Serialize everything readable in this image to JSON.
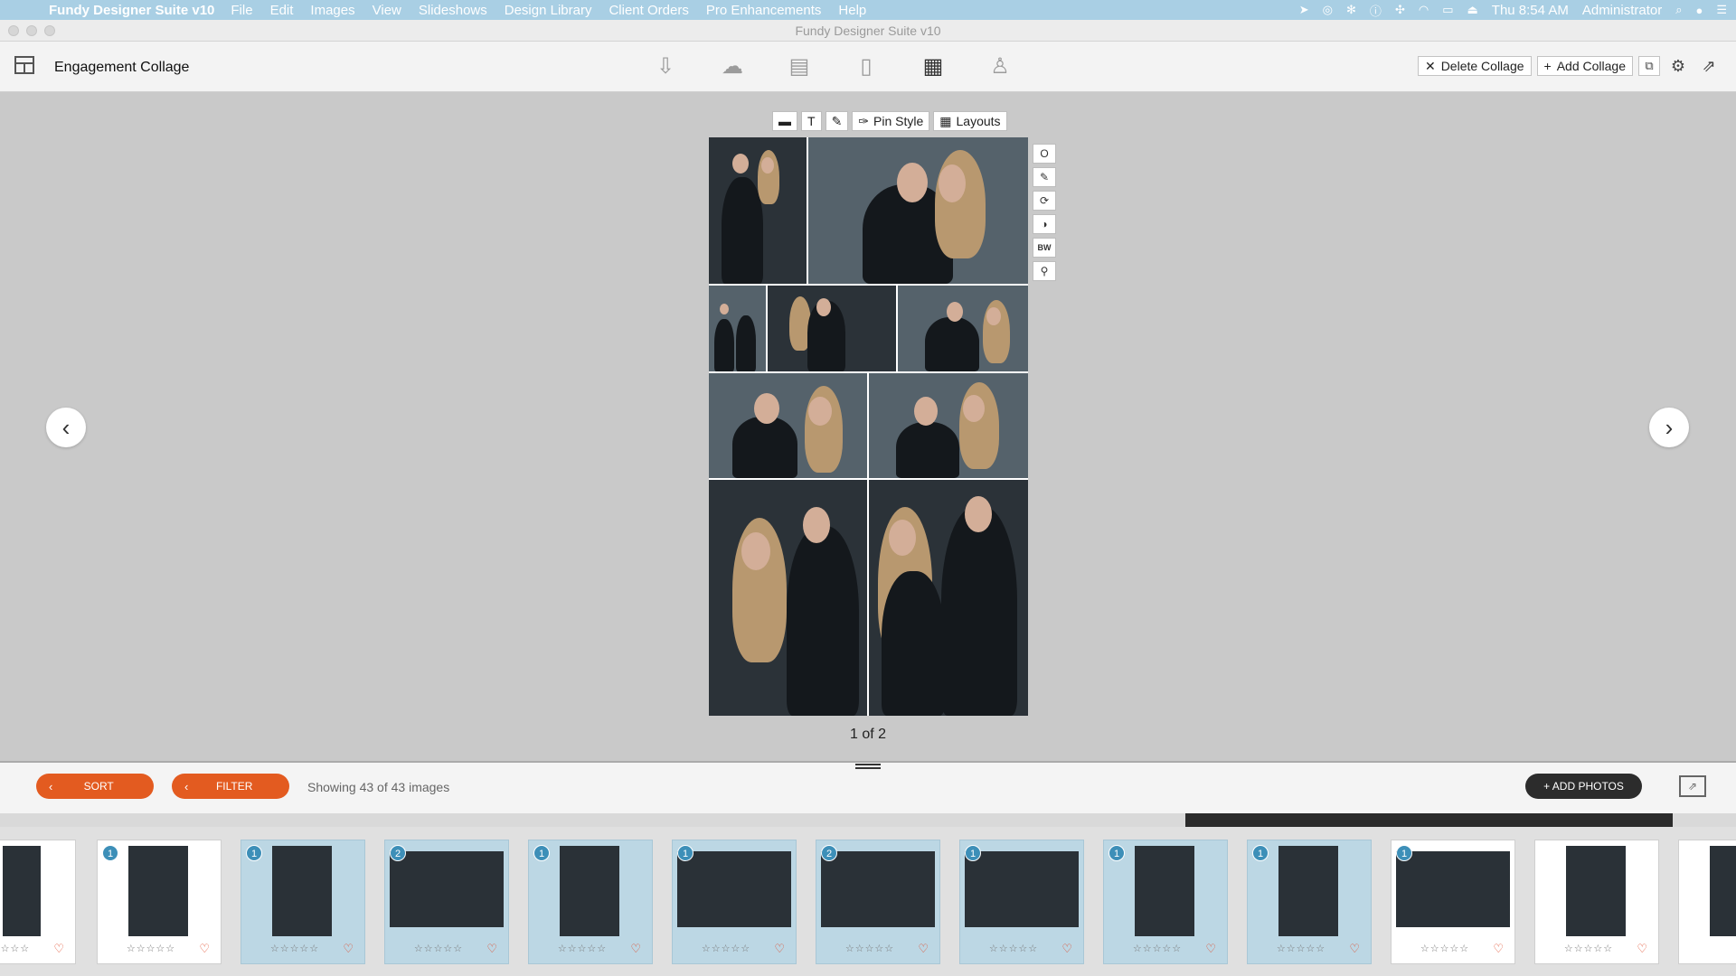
{
  "menubar": {
    "app_name": "Fundy Designer Suite v10",
    "menus": [
      "File",
      "Edit",
      "Images",
      "View",
      "Slideshows",
      "Design Library",
      "Client Orders",
      "Pro Enhancements",
      "Help"
    ],
    "clock": "Thu 8:54 AM",
    "user": "Administrator"
  },
  "window": {
    "title": "Fundy Designer Suite v10"
  },
  "toolbar": {
    "page_title": "Engagement Collage",
    "delete_label": "Delete Collage",
    "add_label": "Add Collage",
    "modules": [
      "import",
      "proofing",
      "album",
      "wall-art",
      "collage",
      "cards"
    ]
  },
  "editor": {
    "pin_style_label": "Pin Style",
    "layouts_label": "Layouts",
    "text_tool": "T",
    "bw_label": "BW",
    "side_tools": [
      "O",
      "✎",
      "⟳",
      "◑",
      "BW",
      "⚲"
    ],
    "page_count": "1 of 2"
  },
  "filmstrip": {
    "sort_label": "SORT",
    "filter_label": "FILTER",
    "showing": "Showing 43 of 43 images",
    "add_photos_label": "+ ADD PHOTOS",
    "stars": "☆☆☆☆☆",
    "thumbs": [
      {
        "badge": "",
        "used": false
      },
      {
        "badge": "1",
        "used": false
      },
      {
        "badge": "1",
        "used": true
      },
      {
        "badge": "2",
        "used": true
      },
      {
        "badge": "1",
        "used": true
      },
      {
        "badge": "1",
        "used": true
      },
      {
        "badge": "2",
        "used": true
      },
      {
        "badge": "1",
        "used": true
      },
      {
        "badge": "1",
        "used": true
      },
      {
        "badge": "1",
        "used": true
      },
      {
        "badge": "1",
        "used": false
      },
      {
        "badge": "",
        "used": false
      },
      {
        "badge": "",
        "used": false
      }
    ]
  },
  "colors": {
    "accent_orange": "#e35b20",
    "menubar_blue": "#a9cfe4",
    "used_thumb": "#bcd7e4",
    "badge_blue": "#3d8fb8"
  }
}
